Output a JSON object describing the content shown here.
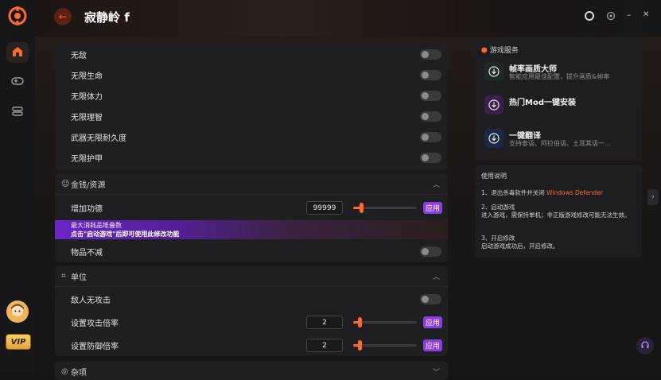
{
  "header": {
    "title": "寂静岭 f"
  },
  "window": {
    "minimize": "–",
    "close": "✕"
  },
  "cheats_top": [
    {
      "label": "无敌"
    },
    {
      "label": "无限生命"
    },
    {
      "label": "无限体力"
    },
    {
      "label": "无限理智"
    },
    {
      "label": "武器无限耐久度"
    },
    {
      "label": "无限护甲"
    }
  ],
  "money": {
    "title": "金钱/资源",
    "add_merit": {
      "label": "增加功德",
      "value": "99999",
      "apply": "应用"
    },
    "banner": {
      "line1": "最大消耗品堆叠数",
      "line2": "点击\"启动游戏\"后即可使用此修改功能"
    },
    "no_decrease": {
      "label": "物品不减"
    }
  },
  "units": {
    "title": "单位",
    "enemy_no_attack": {
      "label": "敌人无攻击"
    },
    "attack_mult": {
      "label": "设置攻击倍率",
      "value": "2",
      "apply": "应用"
    },
    "defense_mult": {
      "label": "设置防御倍率",
      "value": "2",
      "apply": "应用"
    }
  },
  "misc": {
    "title": "杂项"
  },
  "services": {
    "title": "游戏服务",
    "items": [
      {
        "title": "帧率画质大师",
        "subtitle": "智能应用最佳配置，提升画质&帧率"
      },
      {
        "title": "热门Mod一键安装",
        "subtitle": ""
      },
      {
        "title": "一键翻译",
        "subtitle": "支持泰语、阿拉伯语、土耳其语一..."
      }
    ]
  },
  "instructions": {
    "title": "使用说明",
    "step1_prefix": "1、退出杀毒软件并关闭",
    "step1_highlight": "Windows Defender",
    "step2_title": "2、启动游戏",
    "step2_body": "进入游戏，需保持单机；非正版游戏修改可能无法生效。",
    "step3_title": "3、开启修改",
    "step3_body": "启动游戏成功后，开启修改。"
  },
  "vip": "VIP",
  "colors": {
    "accent": "#ff6a2b",
    "apply": "#8c3de0"
  }
}
